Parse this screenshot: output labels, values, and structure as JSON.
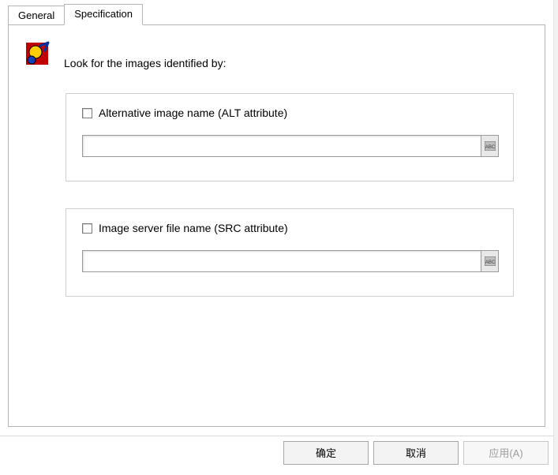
{
  "tabs": {
    "general": "General",
    "specification": "Specification",
    "active": "specification"
  },
  "intro": "Look for the images identified by:",
  "group1": {
    "checkbox_label": "Alternative image name (ALT attribute)",
    "input_value": ""
  },
  "group2": {
    "checkbox_label": "Image server file name (SRC attribute)",
    "input_value": ""
  },
  "buttons": {
    "ok": "确定",
    "cancel": "取消",
    "apply": "应用(A)"
  }
}
